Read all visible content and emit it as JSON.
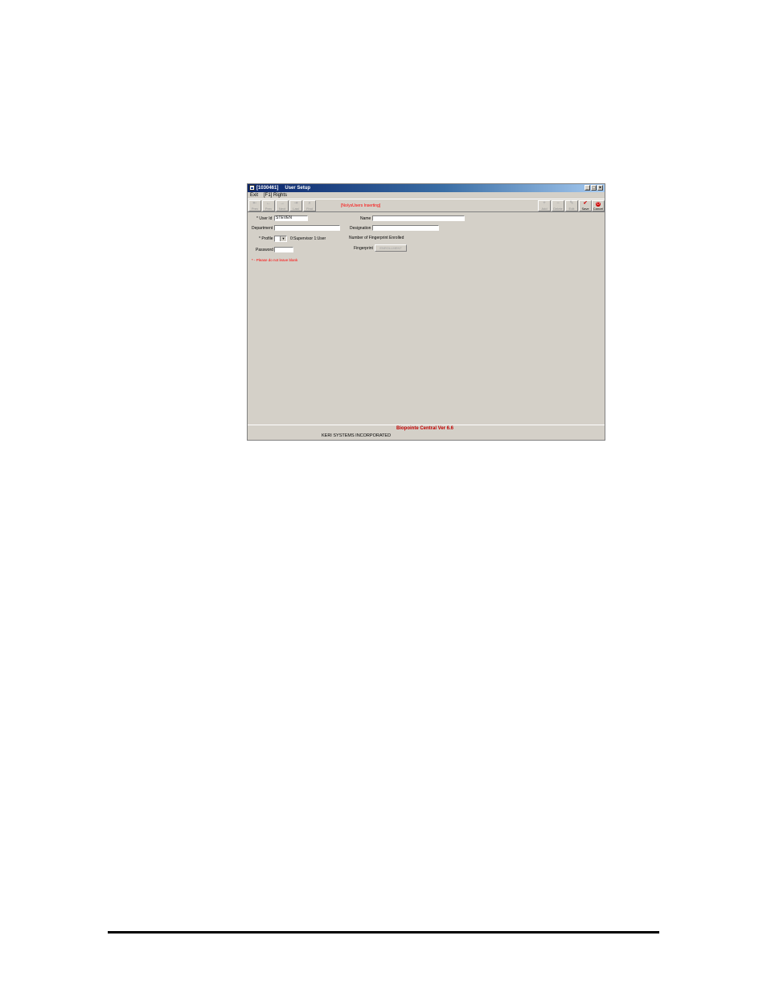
{
  "window": {
    "title_id": "[1030461]",
    "title": "User Setup",
    "controls": [
      "_",
      "□",
      "×"
    ]
  },
  "menu": {
    "items": [
      "Exit",
      "[F1] Rights"
    ]
  },
  "toolbar": {
    "left_buttons": [
      "Prev",
      "Prev",
      "Next",
      "Last",
      "Find"
    ],
    "status_message": "[No/ysUsers Inserting]",
    "right_buttons": [
      "Add",
      "Delete",
      "Edit",
      "Save",
      "Cancel"
    ]
  },
  "form": {
    "user_id_label": "* User Id",
    "user_id_value": "STEVEN",
    "department_label": "Department",
    "department_value": "",
    "profile_label": "* Profile",
    "profile_value": "",
    "profile_options_text": "0:Supervisor 1:User",
    "password_label": "Password",
    "password_value": "",
    "name_label": "Name",
    "name_value": "",
    "designation_label": "Designation",
    "designation_value": "",
    "fingerprint_count_label": "Number of Fingerprint Enrolled",
    "fingerprint_count_value": "",
    "fingerprint_label": "Fingerprint",
    "fingerprint_button": "ENROLLMENT",
    "required_note": "* - Please do not leave blank"
  },
  "footer": {
    "version": "Biopointe Central Ver 6.6",
    "company": "KERI SYSTEMS INCORPORATED"
  }
}
